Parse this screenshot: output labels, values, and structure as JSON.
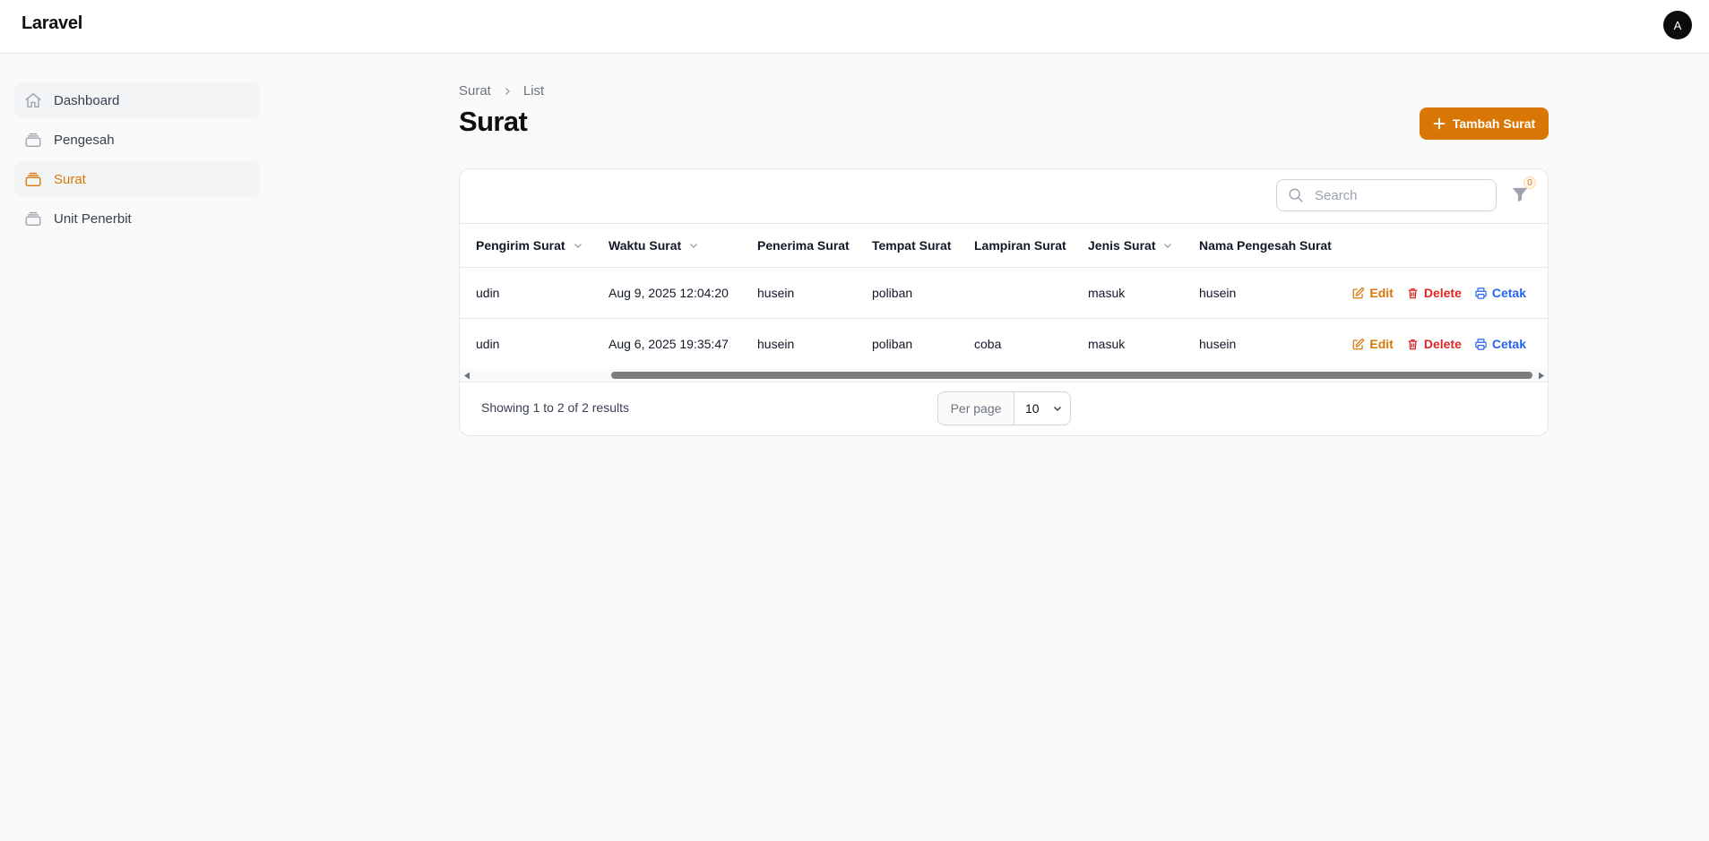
{
  "app": {
    "brand": "Laravel",
    "avatar_initial": "A"
  },
  "sidebar": {
    "items": [
      {
        "label": "Dashboard",
        "icon": "home-icon"
      },
      {
        "label": "Pengesah",
        "icon": "rectangle-stack-icon"
      },
      {
        "label": "Surat",
        "icon": "rectangle-stack-icon",
        "active": true
      },
      {
        "label": "Unit Penerbit",
        "icon": "rectangle-stack-icon"
      }
    ]
  },
  "breadcrumb": {
    "items": [
      "Surat",
      "List"
    ]
  },
  "page": {
    "title": "Surat",
    "add_button": "Tambah Surat"
  },
  "table": {
    "search_placeholder": "Search",
    "filter_count": "0",
    "columns": [
      "Pengirim Surat",
      "Waktu Surat",
      "Penerima Surat",
      "Tempat Surat",
      "Lampiran Surat",
      "Jenis Surat",
      "Nama Pengesah Surat"
    ],
    "rows": [
      [
        "udin",
        "Aug 9, 2025 12:04:20",
        "husein",
        "poliban",
        "",
        "masuk",
        "husein"
      ],
      [
        "udin",
        "Aug 6, 2025 19:35:47",
        "husein",
        "poliban",
        "coba",
        "masuk",
        "husein"
      ]
    ],
    "actions": {
      "edit": "Edit",
      "delete": "Delete",
      "print": "Cetak"
    }
  },
  "pagination": {
    "results_text": "Showing 1 to 2 of 2 results",
    "per_page_label": "Per page",
    "per_page_value": "10"
  },
  "colors": {
    "accent": "#d97706",
    "danger": "#dc2626",
    "info": "#2563eb"
  }
}
